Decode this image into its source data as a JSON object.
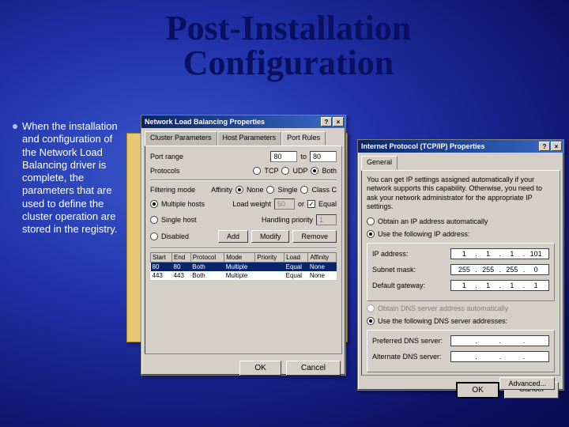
{
  "title": "Post-Installation Configuration",
  "bullet_text": "When the installation and configuration of the Network Load Balancing driver is complete, the parameters that are used to define the cluster operation are stored in the registry.",
  "nlb": {
    "window_title": "Network Load Balancing Properties",
    "tabs": [
      "Cluster Parameters",
      "Host Parameters",
      "Port Rules"
    ],
    "port_range_lbl": "Port range",
    "port_from": "80",
    "port_to_lbl": "to",
    "port_to": "80",
    "protocols_lbl": "Protocols",
    "proto_tcp": "TCP",
    "proto_udp": "UDP",
    "proto_both": "Both",
    "filter_lbl": "Filtering mode",
    "filter_multi": "Multiple hosts",
    "filter_single": "Single host",
    "filter_disabled": "Disabled",
    "affinity_lbl": "Affinity",
    "aff_none": "None",
    "aff_single": "Single",
    "aff_classc": "Class C",
    "load_weight_lbl": "Load weight",
    "load_weight_val": "50",
    "load_or": "or",
    "load_equal": "Equal",
    "hp_lbl": "Handling priority",
    "hp_val": "1",
    "btn_add": "Add",
    "btn_modify": "Modify",
    "btn_remove": "Remove",
    "cols": [
      "Start",
      "End",
      "Protocol",
      "Mode",
      "Priority",
      "Load",
      "Affinity"
    ],
    "rows": [
      [
        "80",
        "80",
        "Both",
        "Multiple",
        "",
        "Equal",
        "None"
      ],
      [
        "443",
        "443",
        "Both",
        "Multiple",
        "",
        "Equal",
        "None"
      ]
    ],
    "ok": "OK",
    "cancel": "Cancel"
  },
  "tcp": {
    "window_title": "Internet Protocol (TCP/IP) Properties",
    "tab_general": "General",
    "blurb": "You can get IP settings assigned automatically if your network supports this capability. Otherwise, you need to ask your network administrator for the appropriate IP settings.",
    "auto_ip": "Obtain an IP address automatically",
    "use_ip": "Use the following IP address:",
    "ip_lbl": "IP address:",
    "ip_val": [
      "1",
      "1",
      "1",
      "101"
    ],
    "mask_lbl": "Subnet mask:",
    "mask_val": [
      "255",
      "255",
      "255",
      "0"
    ],
    "gw_lbl": "Default gateway:",
    "gw_val": [
      "1",
      "1",
      "1",
      "1"
    ],
    "auto_dns": "Obtain DNS server address automatically",
    "use_dns": "Use the following DNS server addresses:",
    "pdns_lbl": "Preferred DNS server:",
    "adns_lbl": "Alternate DNS server:",
    "advanced": "Advanced...",
    "ok": "OK",
    "cancel": "Cancel"
  }
}
